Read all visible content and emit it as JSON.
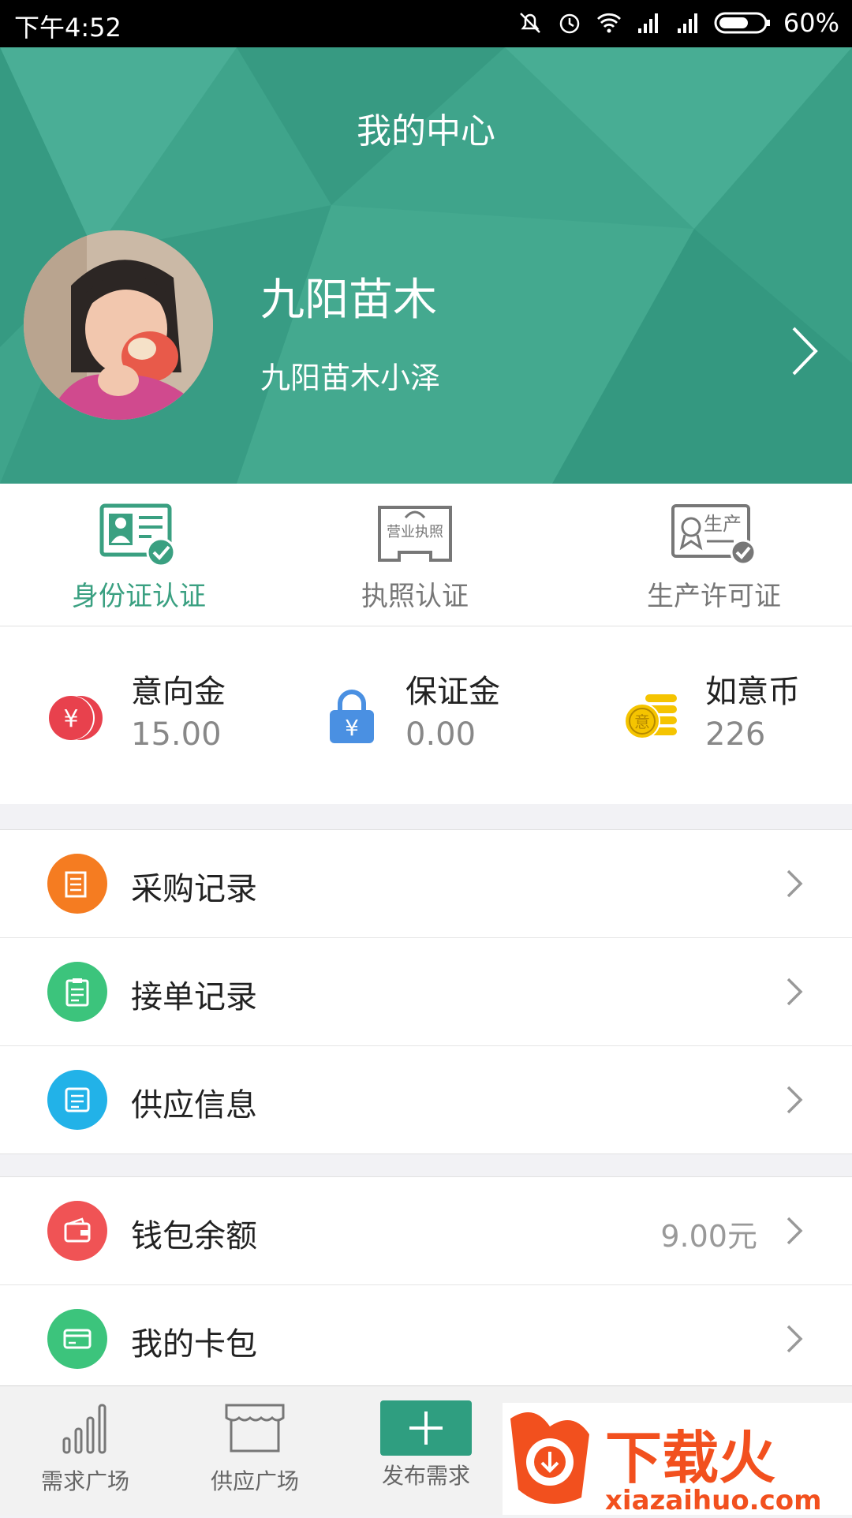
{
  "status_bar": {
    "time": "下午4:52",
    "battery": "60%"
  },
  "header": {
    "title": "我的中心",
    "user_name": "九阳苗木",
    "user_subtitle": "九阳苗木小泽"
  },
  "certifications": [
    {
      "label": "身份证认证",
      "color": "#3aa081",
      "icon": "id-card-verified-icon"
    },
    {
      "label": "执照认证",
      "color": "#777777",
      "icon": "business-license-icon",
      "icon_text": "营业执照"
    },
    {
      "label": "生产许可证",
      "color": "#777777",
      "icon": "production-permit-icon",
      "icon_text": "生产"
    }
  ],
  "wallet": [
    {
      "title": "意向金",
      "value": "15.00",
      "icon": "yuan-coin-icon"
    },
    {
      "title": "保证金",
      "value": "0.00",
      "icon": "lock-yuan-icon"
    },
    {
      "title": "如意币",
      "value": "226",
      "icon": "gold-coins-icon",
      "icon_text": "意"
    }
  ],
  "menu_group1": [
    {
      "label": "采购记录",
      "color": "#f57c21",
      "icon": "purchase-record-icon"
    },
    {
      "label": "接单记录",
      "color": "#3cc47c",
      "icon": "order-record-icon"
    },
    {
      "label": "供应信息",
      "color": "#22b2e8",
      "icon": "supply-info-icon"
    }
  ],
  "menu_group2": [
    {
      "label": "钱包余额",
      "value": "9.00元",
      "color": "#f05355",
      "icon": "wallet-icon"
    },
    {
      "label": "我的卡包",
      "value": "",
      "color": "#3cc47c",
      "icon": "card-icon"
    }
  ],
  "tabbar": [
    {
      "label": "需求广场",
      "icon": "bar-chart-icon"
    },
    {
      "label": "供应广场",
      "icon": "store-icon"
    },
    {
      "label": "发布需求",
      "icon": "plus-icon"
    }
  ],
  "watermark": {
    "brand": "下载火",
    "url": "xiazaihuo.com"
  },
  "colors": {
    "header": "#3fa48b",
    "accent": "#3aa081",
    "publish_button": "#2f9e80"
  }
}
